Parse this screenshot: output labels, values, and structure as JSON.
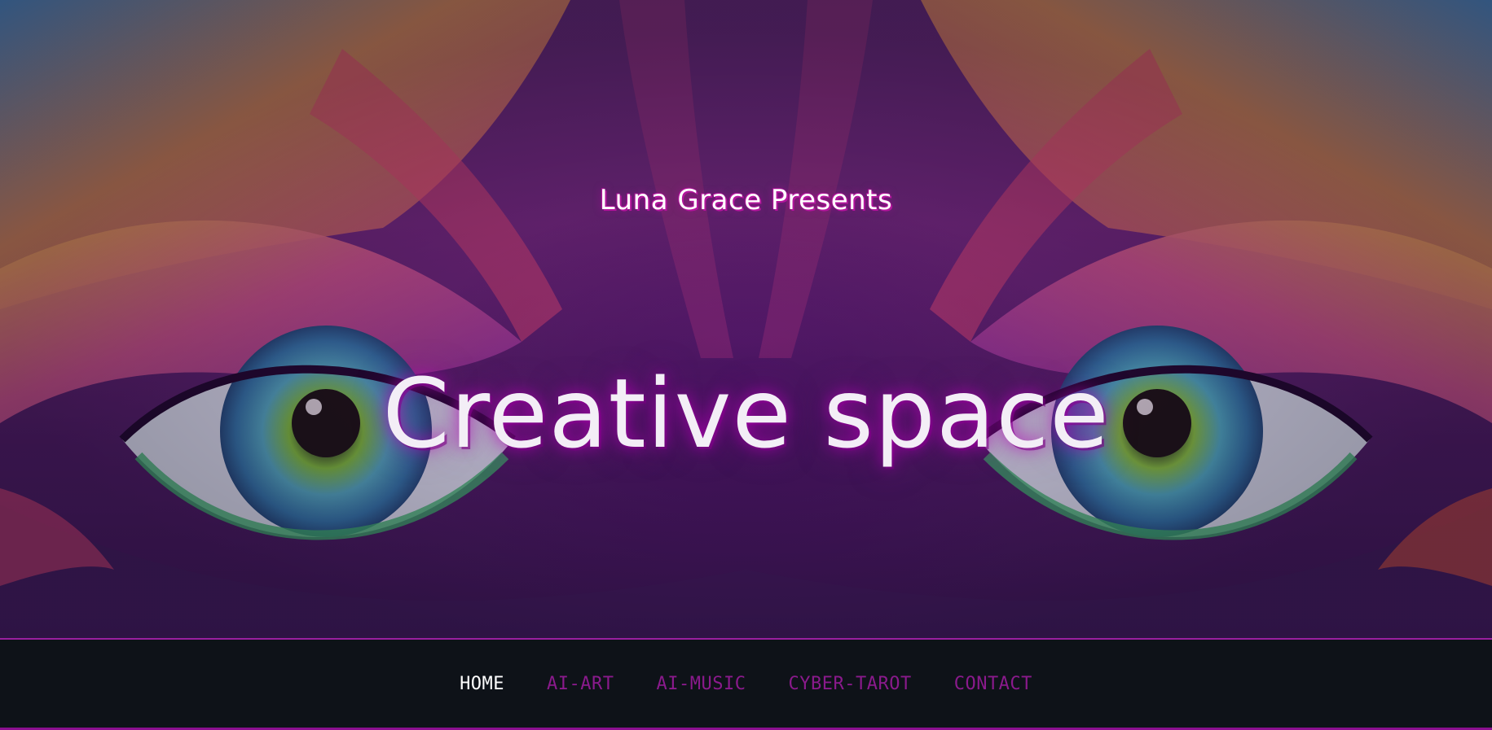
{
  "hero": {
    "presents": "Luna Grace Presents",
    "headline": "Creative space",
    "background_description_colors": [
      "#5a2a6e",
      "#c0367a",
      "#e6a93c",
      "#3bb8c9",
      "#6ac23a"
    ]
  },
  "nav": {
    "items": [
      {
        "label": "HOME",
        "active": true
      },
      {
        "label": "AI-ART",
        "active": false
      },
      {
        "label": "AI-MUSIC",
        "active": false
      },
      {
        "label": "CYBER-TAROT",
        "active": false
      },
      {
        "label": "CONTACT",
        "active": false
      }
    ],
    "active_color": "#ffffff",
    "inactive_color": "#8a1a8c",
    "background": "#0e1218",
    "accent_border": "#8b0f8f"
  }
}
